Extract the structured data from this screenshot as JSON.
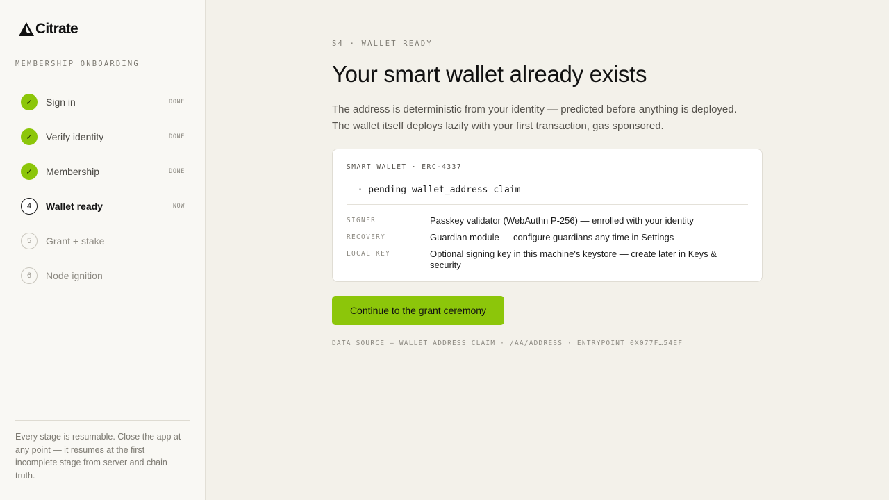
{
  "brand": {
    "name": "Citrate",
    "logo_icon": "triangle-mark-icon"
  },
  "sidebar": {
    "section_label": "MEMBERSHIP ONBOARDING",
    "steps": [
      {
        "marker": "✓",
        "label": "Sign in",
        "status": "DONE",
        "state": "done"
      },
      {
        "marker": "✓",
        "label": "Verify identity",
        "status": "DONE",
        "state": "done"
      },
      {
        "marker": "✓",
        "label": "Membership",
        "status": "DONE",
        "state": "done"
      },
      {
        "marker": "4",
        "label": "Wallet ready",
        "status": "NOW",
        "state": "current"
      },
      {
        "marker": "5",
        "label": "Grant + stake",
        "status": "",
        "state": "pending"
      },
      {
        "marker": "6",
        "label": "Node ignition",
        "status": "",
        "state": "pending"
      }
    ],
    "footer_note": "Every stage is resumable. Close the app at any point — it resumes at the first incomplete stage from server and chain truth."
  },
  "main": {
    "eyebrow": "S4 · WALLET READY",
    "title": "Your smart wallet already exists",
    "lede": "The address is deterministic from your identity — predicted before anything is deployed. The wallet itself deploys lazily with your first transaction, gas sponsored.",
    "card": {
      "label": "SMART WALLET · ERC-4337",
      "address": "— · pending wallet_address claim",
      "rows": [
        {
          "key": "SIGNER",
          "value": "Passkey validator (WebAuthn P-256) — enrolled with your identity"
        },
        {
          "key": "RECOVERY",
          "value": "Guardian module — configure guardians any time in Settings"
        },
        {
          "key": "LOCAL KEY",
          "value": "Optional signing key in this machine's keystore — create later in Keys & security"
        }
      ]
    },
    "cta_label": "Continue to the grant ceremony",
    "data_source": "DATA SOURCE — WALLET_ADDRESS CLAIM · /AA/ADDRESS · ENTRYPOINT 0X077F…54EF"
  },
  "colors": {
    "accent": "#8cc60a",
    "background": "#f3f1ea",
    "sidebar_background": "#f9f8f4",
    "card_background": "#ffffff"
  }
}
